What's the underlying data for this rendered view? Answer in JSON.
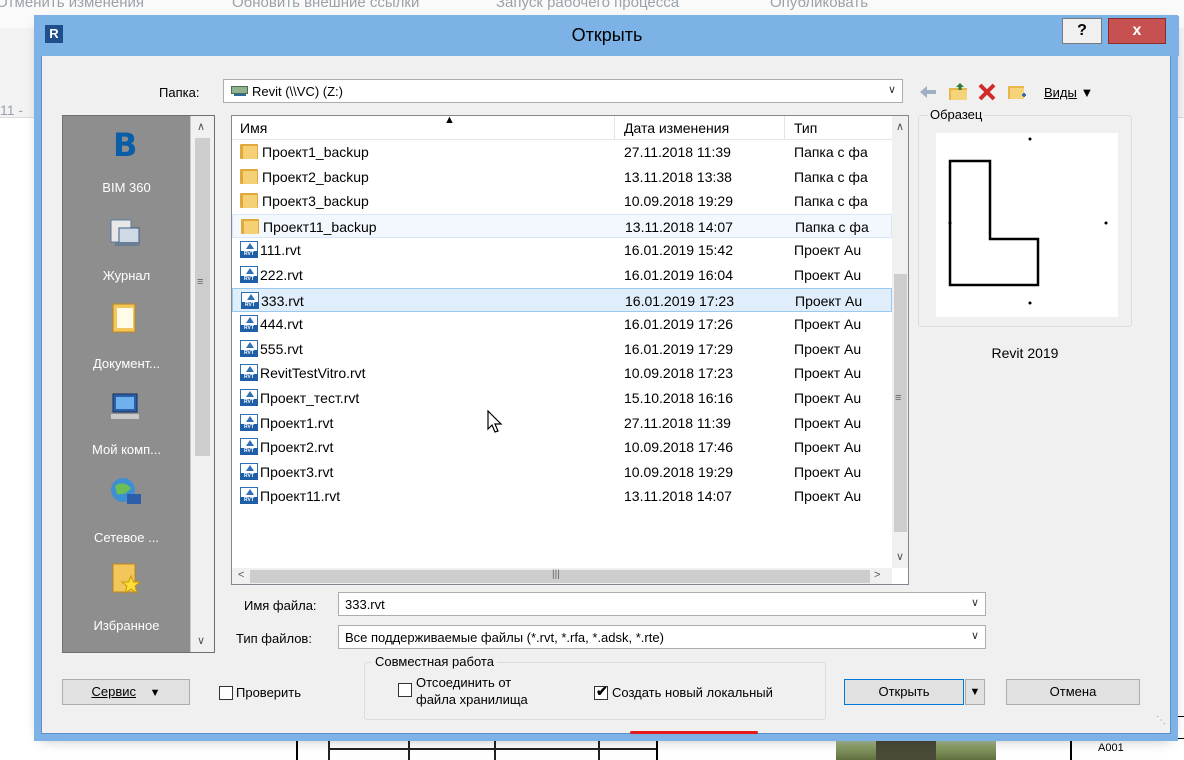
{
  "background": {
    "toolbar_items": [
      "Отменить изменения",
      "Обновить внешние ссылки",
      "Запуск рабочего процесса",
      "Опубликовать"
    ],
    "side_label": "11 -",
    "sheet_number": "A001"
  },
  "dialog": {
    "title": "Открыть",
    "help_label": "?",
    "close_label": "x",
    "folder_label": "Папка:",
    "folder_value": "Revit (\\\\VC) (Z:)",
    "views_label": "Виды",
    "toolbar_icons": [
      "back-arrow-icon",
      "up-folder-icon",
      "delete-icon",
      "new-folder-icon"
    ],
    "places": [
      {
        "label": "BIM 360",
        "icon": "bim360-icon"
      },
      {
        "label": "Журнал",
        "icon": "history-icon"
      },
      {
        "label": "Документ...",
        "icon": "documents-icon"
      },
      {
        "label": "Мой комп...",
        "icon": "my-computer-icon"
      },
      {
        "label": "Сетевое ...",
        "icon": "network-icon"
      },
      {
        "label": "Избранное",
        "icon": "favorites-icon"
      }
    ],
    "columns": {
      "name": "Имя",
      "date": "Дата изменения",
      "type": "Тип"
    },
    "files": [
      {
        "name": "Проект1_backup",
        "date": "27.11.2018 11:39",
        "type": "Папка с фа",
        "kind": "folder"
      },
      {
        "name": "Проект2_backup",
        "date": "13.11.2018 13:38",
        "type": "Папка с фа",
        "kind": "folder"
      },
      {
        "name": "Проект3_backup",
        "date": "10.09.2018 19:29",
        "type": "Папка с фа",
        "kind": "folder"
      },
      {
        "name": "Проект11_backup",
        "date": "13.11.2018 14:07",
        "type": "Папка с фа",
        "kind": "folder"
      },
      {
        "name": "111.rvt",
        "date": "16.01.2019 15:42",
        "type": "Проект Au",
        "kind": "rvt"
      },
      {
        "name": "222.rvt",
        "date": "16.01.2019 16:04",
        "type": "Проект Au",
        "kind": "rvt"
      },
      {
        "name": "333.rvt",
        "date": "16.01.2019 17:23",
        "type": "Проект Au",
        "kind": "rvt"
      },
      {
        "name": "444.rvt",
        "date": "16.01.2019 17:26",
        "type": "Проект Au",
        "kind": "rvt"
      },
      {
        "name": "555.rvt",
        "date": "16.01.2019 17:29",
        "type": "Проект Au",
        "kind": "rvt"
      },
      {
        "name": "RevitTestVitro.rvt",
        "date": "10.09.2018 17:23",
        "type": "Проект Au",
        "kind": "rvt"
      },
      {
        "name": "Проект_тест.rvt",
        "date": "15.10.2018 16:16",
        "type": "Проект Au",
        "kind": "rvt"
      },
      {
        "name": "Проект1.rvt",
        "date": "27.11.2018 11:39",
        "type": "Проект Au",
        "kind": "rvt"
      },
      {
        "name": "Проект2.rvt",
        "date": "10.09.2018 17:46",
        "type": "Проект Au",
        "kind": "rvt"
      },
      {
        "name": "Проект3.rvt",
        "date": "10.09.2018 19:29",
        "type": "Проект Au",
        "kind": "rvt"
      },
      {
        "name": "Проект11.rvt",
        "date": "13.11.2018 14:07",
        "type": "Проект Au",
        "kind": "rvt"
      }
    ],
    "selected_file": "333.rvt",
    "hovered_file": "Проект11_backup",
    "preview_label": "Образец",
    "preview_version": "Revit 2019",
    "filename_label": "Имя файла:",
    "filename_value": "333.rvt",
    "filetype_label": "Тип файлов:",
    "filetype_value": "Все поддерживаемые файлы  (*.rvt, *.rfa, *.adsk, *.rte)",
    "collab_label": "Совместная работа",
    "detach_label_1": "Отсоединить от",
    "detach_label_2": "файла хранилища",
    "detach_checked": false,
    "create_local_label": "Создать новый локальный",
    "create_local_checked": true,
    "audit_label": "Проверить",
    "audit_checked": false,
    "service_label": "Сервис",
    "open_label": "Открыть",
    "cancel_label": "Отмена",
    "highlight_color": "#e31b1b",
    "title_bar_color": "#7db2e6"
  }
}
